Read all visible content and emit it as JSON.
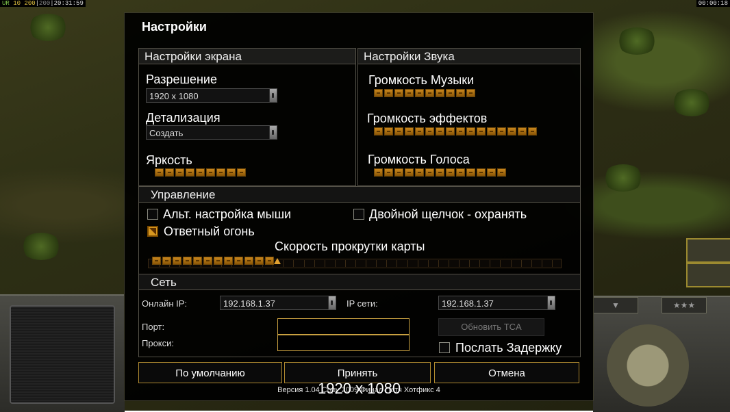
{
  "hud": {
    "top_left": {
      "ur": "UR",
      "val1": "10",
      "val2": "200",
      "val3": "200",
      "time": "20:31:59"
    },
    "top_right_time": "00:00:18"
  },
  "dialog": {
    "title": "Настройки",
    "display": {
      "header": "Настройки экрана",
      "resolution_label": "Разрешение",
      "resolution_value": "1920 x 1080",
      "detail_label": "Детализация",
      "detail_value": "Создать",
      "brightness_label": "Яркость",
      "brightness_level": 9
    },
    "sound": {
      "header": "Настройки Звука",
      "music_label": "Громкость Музыки",
      "music_level": 10,
      "effects_label": "Громкость эффектов",
      "effects_level": 16,
      "voice_label": "Громкость Голоса",
      "voice_level": 13
    },
    "controls": {
      "header": "Управление",
      "alt_mouse_label": "Альт. настройка мыши",
      "alt_mouse_checked": false,
      "double_click_label": "Двойной щелчок - охранять",
      "double_click_checked": false,
      "return_fire_label": "Ответный огонь",
      "return_fire_checked": true,
      "scroll_speed_label": "Скорость прокрутки карты",
      "scroll_speed_level": 12,
      "scroll_speed_max": 40
    },
    "network": {
      "header": "Сеть",
      "online_ip_label": "Онлайн IP:",
      "online_ip_value": "192.168.1.37",
      "lan_ip_label": "IP сети:",
      "lan_ip_value": "192.168.1.37",
      "port_label": "Порт:",
      "port_value": "",
      "proxy_label": "Прокси:",
      "proxy_value": "",
      "update_tca_label": "Обновить TCA",
      "send_delay_label": "Послать Задержку",
      "send_delay_checked": false
    },
    "buttons": {
      "default": "По умолчанию",
      "accept": "Принять",
      "cancel": "Отмена"
    },
    "version": "Версия 1.04 Copy 2009 Финал Патч Хотфикс 4",
    "overlay_resolution": "1920 x 1080"
  },
  "colors": {
    "accent": "#d89820",
    "border": "#b08a30",
    "panel_border": "#555248"
  }
}
